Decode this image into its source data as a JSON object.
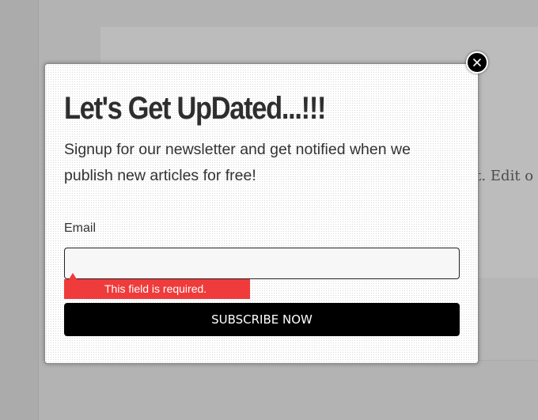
{
  "background": {
    "partial_text": "st. Edit o"
  },
  "popup": {
    "title": "Let's Get UpDated...!!!",
    "subtitle": "Signup for our newsletter and get notified when we publish new articles for free!",
    "email_label": "Email",
    "email_value": "",
    "email_placeholder": "",
    "error_message": "This field is required.",
    "subscribe_label": "SUBSCRIBE NOW",
    "close_icon": "close-icon"
  },
  "colors": {
    "overlay": "#b3b3b3",
    "error": "#ef3b3b",
    "button": "#000000",
    "button_text": "#ffffff"
  }
}
